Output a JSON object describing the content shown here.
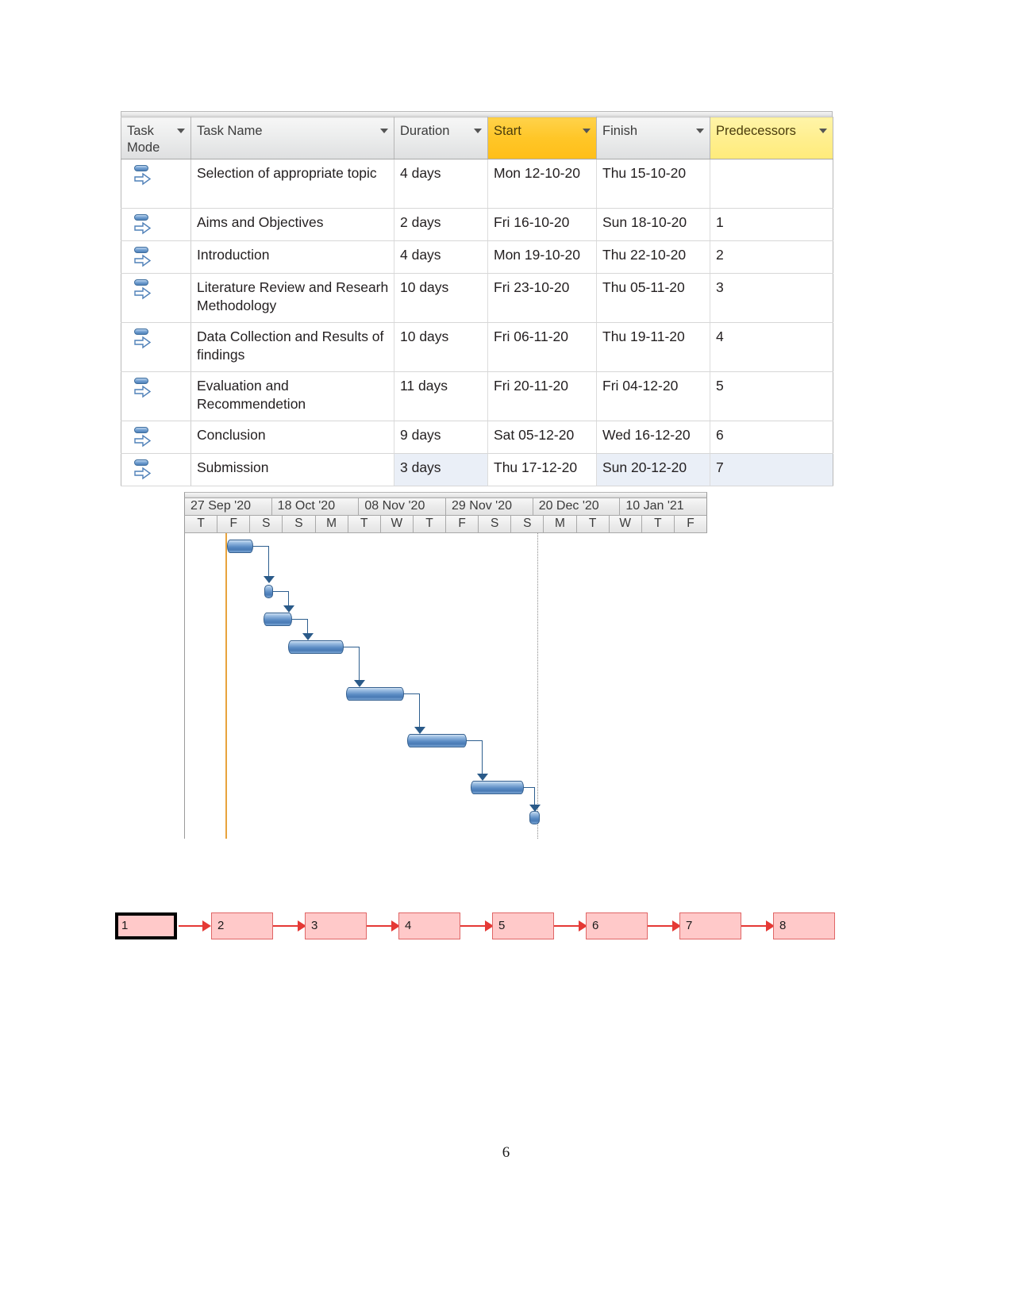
{
  "document": {
    "page_number": "6"
  },
  "task_table": {
    "columns": [
      {
        "label": "Task Mode",
        "has_dropdown": true,
        "highlight": "none"
      },
      {
        "label": "Task Name",
        "has_dropdown": true,
        "highlight": "none"
      },
      {
        "label": "Duration",
        "has_dropdown": true,
        "highlight": "none"
      },
      {
        "label": "Start",
        "has_dropdown": true,
        "highlight": "amber"
      },
      {
        "label": "Finish",
        "has_dropdown": true,
        "highlight": "none"
      },
      {
        "label": "Predecessors",
        "has_dropdown": true,
        "highlight": "yellow"
      }
    ],
    "rows": [
      {
        "mode_icon": "auto-schedule-icon",
        "name": "Selection of appropriate topic",
        "duration": "4 days",
        "start": "Mon 12-10-20",
        "finish": "Thu 15-10-20",
        "predecessors": ""
      },
      {
        "mode_icon": "auto-schedule-icon",
        "name": "Aims and Objectives",
        "duration": "2 days",
        "start": "Fri 16-10-20",
        "finish": "Sun 18-10-20",
        "predecessors": "1"
      },
      {
        "mode_icon": "auto-schedule-icon",
        "name": "Introduction",
        "duration": "4 days",
        "start": "Mon 19-10-20",
        "finish": "Thu 22-10-20",
        "predecessors": "2"
      },
      {
        "mode_icon": "auto-schedule-icon",
        "name": "Literature Review and Researh Methodology",
        "duration": "10 days",
        "start": "Fri 23-10-20",
        "finish": "Thu 05-11-20",
        "predecessors": "3"
      },
      {
        "mode_icon": "auto-schedule-icon",
        "name": "Data Collection and Results of findings",
        "duration": "10 days",
        "start": "Fri 06-11-20",
        "finish": "Thu 19-11-20",
        "predecessors": "4"
      },
      {
        "mode_icon": "auto-schedule-icon",
        "name": "Evaluation and Recommendetion",
        "duration": "11 days",
        "start": "Fri 20-11-20",
        "finish": "Fri 04-12-20",
        "predecessors": "5"
      },
      {
        "mode_icon": "auto-schedule-icon",
        "name": "Conclusion",
        "duration": "9 days",
        "start": "Sat 05-12-20",
        "finish": "Wed 16-12-20",
        "predecessors": "6"
      },
      {
        "mode_icon": "auto-schedule-icon",
        "name": "Submission",
        "duration": "3 days",
        "start": "Thu 17-12-20",
        "finish": "Sun 20-12-20",
        "predecessors": "7"
      }
    ]
  },
  "chart_data": {
    "type": "bar",
    "chart_kind": "gantt",
    "title": "",
    "xlabel": "",
    "ylabel": "",
    "timescale": {
      "weeks": [
        "27 Sep '20",
        "18 Oct '20",
        "08 Nov '20",
        "29 Nov '20",
        "20 Dec '20",
        "10 Jan '21"
      ],
      "days": [
        "T",
        "F",
        "S",
        "S",
        "M",
        "T",
        "W",
        "T",
        "F",
        "S",
        "S",
        "M",
        "T",
        "W",
        "T",
        "F"
      ],
      "axis_start": "27 Sep '20",
      "axis_end": "10 Jan '21",
      "grid": true
    },
    "markers": {
      "today_line_color": "#e8a33d",
      "status_line_style": "dotted"
    },
    "bar_color": "#5b8cc4",
    "bar_border_color": "#35608f",
    "link_color": "#2e5f8f",
    "categories": [
      "Selection of appropriate topic",
      "Aims and Objectives",
      "Introduction",
      "Literature Review and Researh Methodology",
      "Data Collection and Results of findings",
      "Evaluation and Recommendetion",
      "Conclusion",
      "Submission"
    ],
    "values": [
      4,
      2,
      4,
      10,
      10,
      11,
      9,
      3
    ],
    "bars": [
      {
        "task": "Selection of appropriate topic",
        "start": "Mon 12-10-20",
        "finish": "Thu 15-10-20",
        "duration_days": 4,
        "left_pct": 8.1,
        "width_pct": 5.1,
        "row": 0
      },
      {
        "task": "Aims and Objectives",
        "start": "Fri 16-10-20",
        "finish": "Sun 18-10-20",
        "duration_days": 2,
        "left_pct": 13.2,
        "width_pct": 2.0,
        "row": 1
      },
      {
        "task": "Introduction",
        "start": "Mon 19-10-20",
        "finish": "Thu 22-10-20",
        "duration_days": 4,
        "left_pct": 15.2,
        "width_pct": 5.1,
        "row": 2
      },
      {
        "task": "Literature Review and Researh Methodology",
        "start": "Fri 23-10-20",
        "finish": "Thu 05-11-20",
        "duration_days": 10,
        "left_pct": 20.3,
        "width_pct": 10.4,
        "row": 3
      },
      {
        "task": "Data Collection and Results of findings",
        "start": "Fri 06-11-20",
        "finish": "Thu 19-11-20",
        "duration_days": 10,
        "left_pct": 31.2,
        "width_pct": 10.4,
        "row": 4
      },
      {
        "task": "Evaluation and Recommendetion",
        "start": "Fri 20-11-20",
        "finish": "Fri 04-12-20",
        "duration_days": 11,
        "left_pct": 42.1,
        "width_pct": 11.4,
        "row": 5
      },
      {
        "task": "Conclusion",
        "start": "Sat 05-12-20",
        "finish": "Wed 16-12-20",
        "duration_days": 9,
        "left_pct": 54.5,
        "width_pct": 9.5,
        "row": 6
      },
      {
        "task": "Submission",
        "start": "Thu 17-12-20",
        "finish": "Sun 20-12-20",
        "duration_days": 3,
        "left_pct": 65.7,
        "width_pct": 2.0,
        "row": 7
      }
    ],
    "dependencies": [
      {
        "from": 1,
        "to": 2,
        "type": "FS"
      },
      {
        "from": 2,
        "to": 3,
        "type": "FS"
      },
      {
        "from": 3,
        "to": 4,
        "type": "FS"
      },
      {
        "from": 4,
        "to": 5,
        "type": "FS"
      },
      {
        "from": 5,
        "to": 6,
        "type": "FS"
      },
      {
        "from": 6,
        "to": 7,
        "type": "FS"
      },
      {
        "from": 7,
        "to": 8,
        "type": "FS"
      }
    ]
  },
  "network_diagram": {
    "node_fill": "#ffc9c9",
    "node_border": "#e06666",
    "arrow_color": "#e53935",
    "nodes": [
      {
        "label": "1",
        "selected": true
      },
      {
        "label": "2",
        "selected": false
      },
      {
        "label": "3",
        "selected": false
      },
      {
        "label": "4",
        "selected": false
      },
      {
        "label": "5",
        "selected": false
      },
      {
        "label": "6",
        "selected": false
      },
      {
        "label": "7",
        "selected": false
      },
      {
        "label": "8",
        "selected": false
      }
    ]
  }
}
